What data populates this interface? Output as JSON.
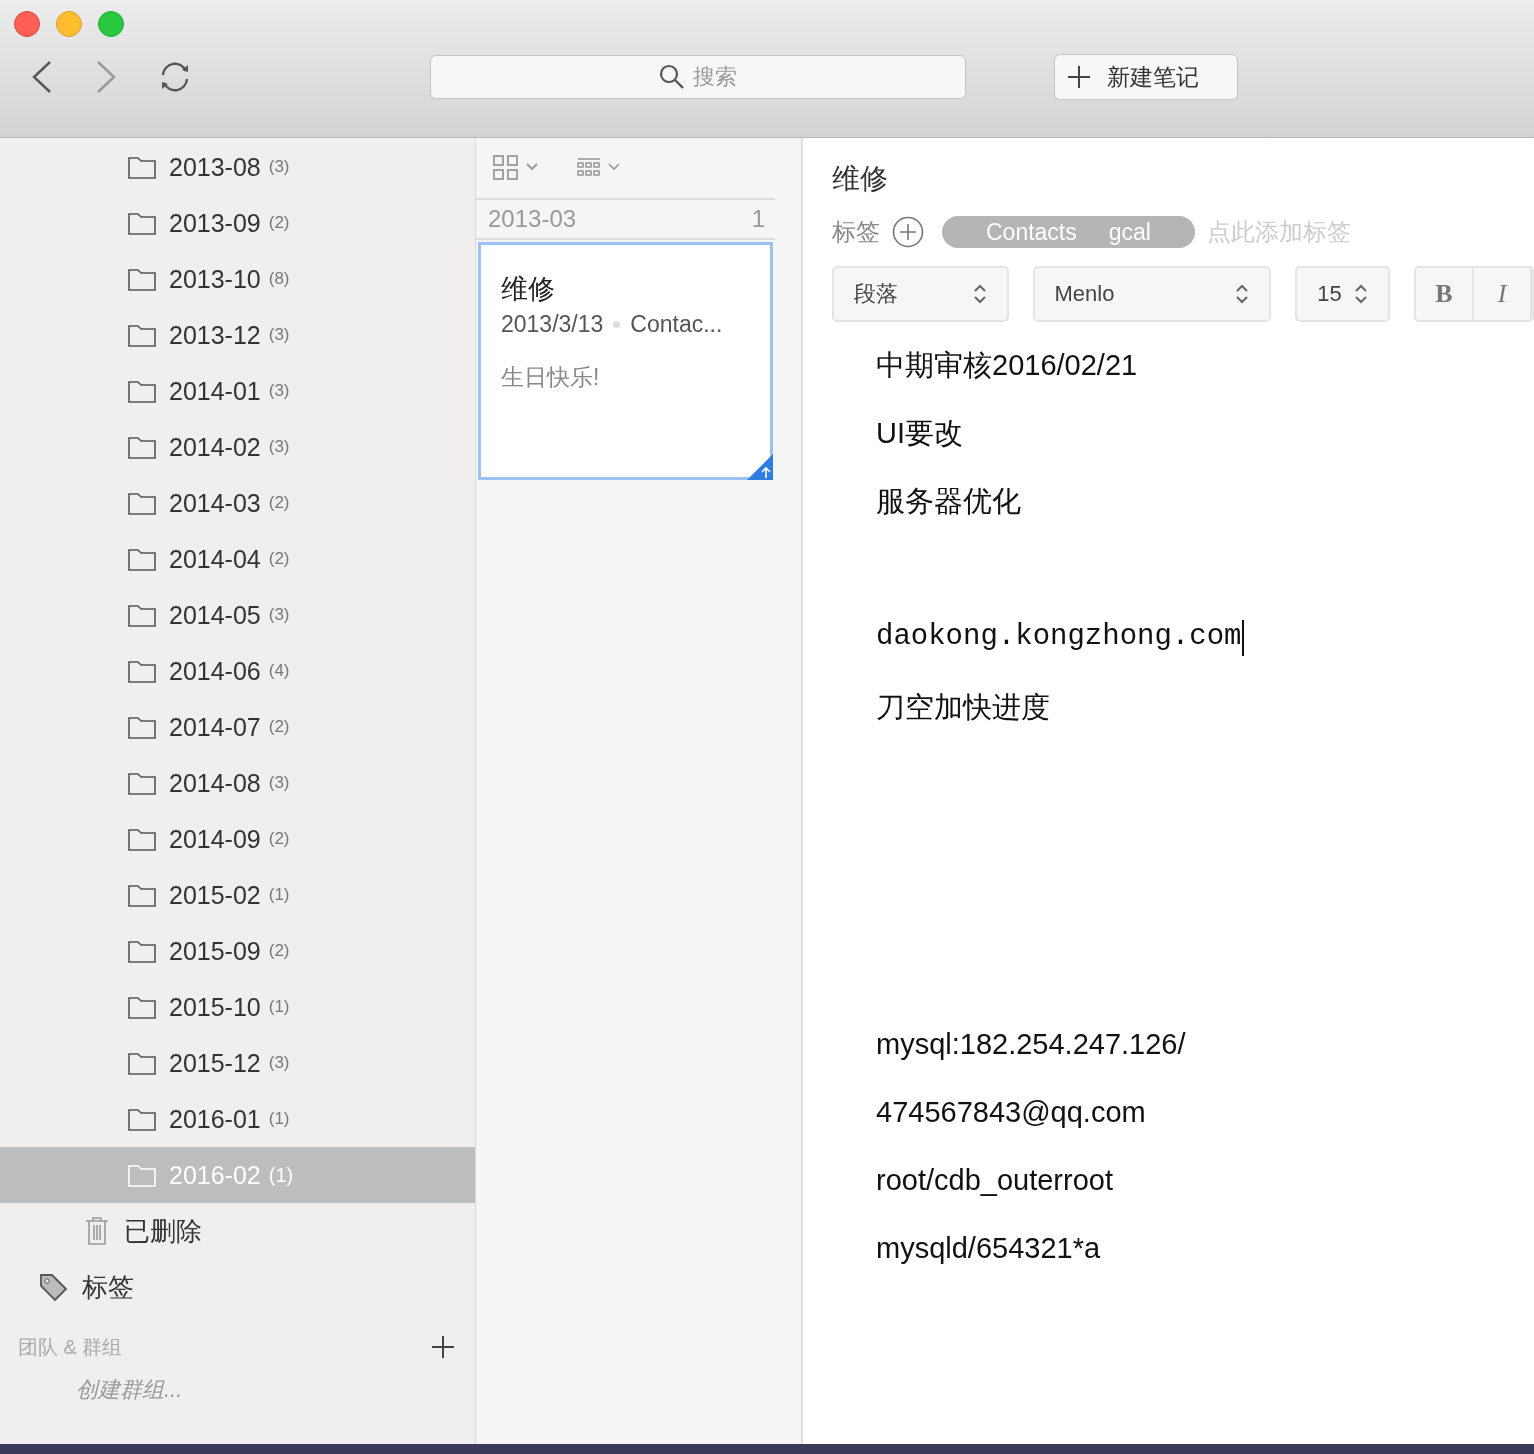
{
  "toolbar": {
    "search": {
      "placeholder": "搜索"
    },
    "new_note": "新建笔记"
  },
  "sidebar": {
    "folders": [
      {
        "name": "2013-08",
        "count": "(3)",
        "selected": false
      },
      {
        "name": "2013-09",
        "count": "(2)",
        "selected": false
      },
      {
        "name": "2013-10",
        "count": "(8)",
        "selected": false
      },
      {
        "name": "2013-12",
        "count": "(3)",
        "selected": false
      },
      {
        "name": "2014-01",
        "count": "(3)",
        "selected": false
      },
      {
        "name": "2014-02",
        "count": "(3)",
        "selected": false
      },
      {
        "name": "2014-03",
        "count": "(2)",
        "selected": false
      },
      {
        "name": "2014-04",
        "count": "(2)",
        "selected": false
      },
      {
        "name": "2014-05",
        "count": "(3)",
        "selected": false
      },
      {
        "name": "2014-06",
        "count": "(4)",
        "selected": false
      },
      {
        "name": "2014-07",
        "count": "(2)",
        "selected": false
      },
      {
        "name": "2014-08",
        "count": "(3)",
        "selected": false
      },
      {
        "name": "2014-09",
        "count": "(2)",
        "selected": false
      },
      {
        "name": "2015-02",
        "count": "(1)",
        "selected": false
      },
      {
        "name": "2015-09",
        "count": "(2)",
        "selected": false
      },
      {
        "name": "2015-10",
        "count": "(1)",
        "selected": false
      },
      {
        "name": "2015-12",
        "count": "(3)",
        "selected": false
      },
      {
        "name": "2016-01",
        "count": "(1)",
        "selected": false
      },
      {
        "name": "2016-02",
        "count": "(1)",
        "selected": true
      }
    ],
    "trash": "已删除",
    "tags": "标签",
    "groups_header": "团队 & 群组",
    "create_group": "创建群组..."
  },
  "note_list": {
    "group": {
      "title": "2013-03",
      "count": "1"
    },
    "notes": [
      {
        "title": "维修",
        "date": "2013/3/13",
        "tag": "Contac...",
        "snippet": "生日快乐!",
        "selected": true
      }
    ]
  },
  "editor": {
    "title": "维修",
    "tags_label": "标签",
    "tags": [
      "Contacts",
      "gcal"
    ],
    "add_tag_placeholder": "点此添加标签",
    "format": {
      "style": "段落",
      "font": "Menlo",
      "size": "15",
      "bold": "B",
      "italic": "I"
    },
    "blocks": [
      {
        "lines": [
          {
            "text": "中期审核2016/02/21",
            "kind": "text",
            "cursor": false
          },
          {
            "text": "UI要改",
            "kind": "text",
            "cursor": false
          },
          {
            "text": "服务器优化",
            "kind": "text",
            "cursor": false
          }
        ]
      },
      {
        "lines": [
          {
            "text": "daokong.kongzhong.com",
            "kind": "mono",
            "cursor": true
          },
          {
            "text": "刀空加快进度",
            "kind": "text",
            "cursor": false
          }
        ]
      },
      {
        "lines": [
          {
            "text": "mysql:182.254.247.126/",
            "kind": "text",
            "cursor": false
          },
          {
            "text": "474567843@qq.com",
            "kind": "text",
            "cursor": false
          },
          {
            "text": "root/cdb_outerroot",
            "kind": "text",
            "cursor": false
          },
          {
            "text": "mysqld/654321*a",
            "kind": "text",
            "cursor": false
          }
        ]
      }
    ]
  }
}
